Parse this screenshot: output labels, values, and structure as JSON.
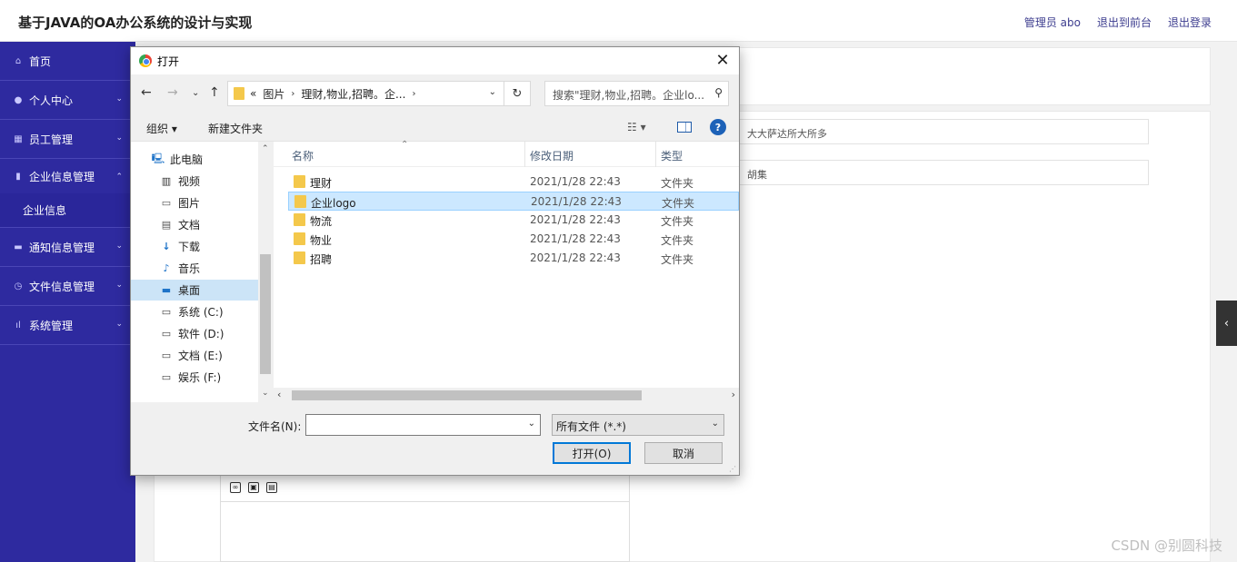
{
  "app": {
    "title": "基于JAVA的OA办公系统的设计与实现",
    "header_links": [
      "管理员 abo",
      "退出到前台",
      "退出登录"
    ]
  },
  "sidebar": {
    "items": [
      {
        "label": "首页",
        "icon": "home-icon"
      },
      {
        "label": "个人中心",
        "icon": "user-icon"
      },
      {
        "label": "员工管理",
        "icon": "grid-icon"
      },
      {
        "label": "企业信息管理",
        "icon": "bar-icon",
        "open": true
      },
      {
        "label": "企业信息",
        "sub": true
      },
      {
        "label": "通知信息管理",
        "icon": "monitor-icon"
      },
      {
        "label": "文件信息管理",
        "icon": "clock-icon"
      },
      {
        "label": "系统管理",
        "icon": "chart-icon"
      }
    ]
  },
  "main": {
    "fields": [
      "大大萨达所大所多",
      "胡集"
    ]
  },
  "dialog": {
    "title": "打开",
    "address": {
      "prefix": "«",
      "crumbs": [
        "图片",
        "理财,物业,招聘。企..."
      ]
    },
    "search_placeholder": "搜索\"理财,物业,招聘。企业lo...",
    "toolbar": {
      "organize": "组织 ▾",
      "new_folder": "新建文件夹"
    },
    "tree": [
      {
        "label": "此电脑",
        "icon": "computer-icon"
      },
      {
        "label": "视频",
        "icon": "video-icon"
      },
      {
        "label": "图片",
        "icon": "picture-icon"
      },
      {
        "label": "文档",
        "icon": "document-icon"
      },
      {
        "label": "下载",
        "icon": "download-icon"
      },
      {
        "label": "音乐",
        "icon": "music-icon"
      },
      {
        "label": "桌面",
        "icon": "desktop-icon",
        "selected": true
      },
      {
        "label": "系统 (C:)",
        "icon": "drive-icon"
      },
      {
        "label": "软件 (D:)",
        "icon": "drive-icon"
      },
      {
        "label": "文档 (E:)",
        "icon": "drive-icon"
      },
      {
        "label": "娱乐 (F:)",
        "icon": "drive-icon"
      }
    ],
    "columns": [
      "名称",
      "修改日期",
      "类型"
    ],
    "files": [
      {
        "name": "理财",
        "date": "2021/1/28 22:43",
        "type": "文件夹"
      },
      {
        "name": "企业logo",
        "date": "2021/1/28 22:43",
        "type": "文件夹",
        "selected": true
      },
      {
        "name": "物流",
        "date": "2021/1/28 22:43",
        "type": "文件夹"
      },
      {
        "name": "物业",
        "date": "2021/1/28 22:43",
        "type": "文件夹"
      },
      {
        "name": "招聘",
        "date": "2021/1/28 22:43",
        "type": "文件夹"
      }
    ],
    "filename_label": "文件名(N):",
    "filename_value": "",
    "filetype": "所有文件 (*.*)",
    "open_label": "打开(O)",
    "cancel_label": "取消"
  },
  "watermark": "CSDN @别圆科技"
}
